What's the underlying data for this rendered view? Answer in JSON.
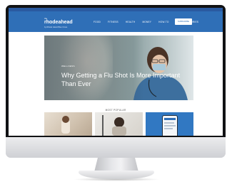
{
  "site": {
    "topbar_text": "",
    "logo_prefix": "the",
    "logo_name": "rhodeahead",
    "logo_tagline": "by Rhode Island Blue Cross"
  },
  "nav": {
    "items": [
      "FOOD",
      "FITNESS",
      "HEALTH",
      "MONEY",
      "HOW-TO",
      "MEMBER STORIES"
    ],
    "subscribe_label": "SUBSCRIBE"
  },
  "hero": {
    "category": "WELLNESS",
    "title": "Why Getting a Flu Shot Is More Important Than Ever"
  },
  "section": {
    "most_popular_label": "MOST POPULAR"
  },
  "colors": {
    "brand_blue": "#2f6fb7",
    "topbar_blue": "#2a5aa0"
  }
}
